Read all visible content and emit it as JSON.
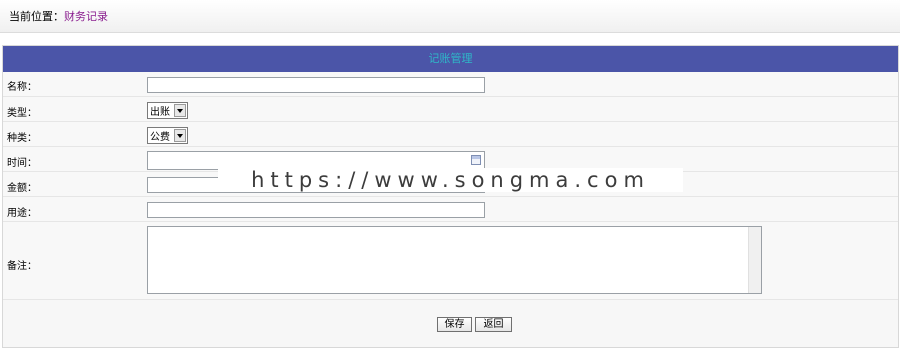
{
  "breadcrumb": {
    "prefix": "当前位置：",
    "current": "财务记录"
  },
  "panel": {
    "title": "记账管理"
  },
  "form": {
    "name": {
      "label": "名称：",
      "value": ""
    },
    "type": {
      "label": "类型：",
      "selected": "出账"
    },
    "category": {
      "label": "种类：",
      "selected": "公费"
    },
    "time": {
      "label": "时间：",
      "value": "",
      "icon": "calendar-icon"
    },
    "amount": {
      "label": "金额：",
      "value": ""
    },
    "purpose": {
      "label": "用途：",
      "value": ""
    },
    "remark": {
      "label": "备注：",
      "value": ""
    }
  },
  "buttons": {
    "save": "保存",
    "back": "返回"
  },
  "watermark": "https://www.songma.com",
  "colors": {
    "header_bg": "#4b55a8",
    "header_text": "#2fb7c8",
    "breadcrumb_current": "#8a1f8f"
  }
}
